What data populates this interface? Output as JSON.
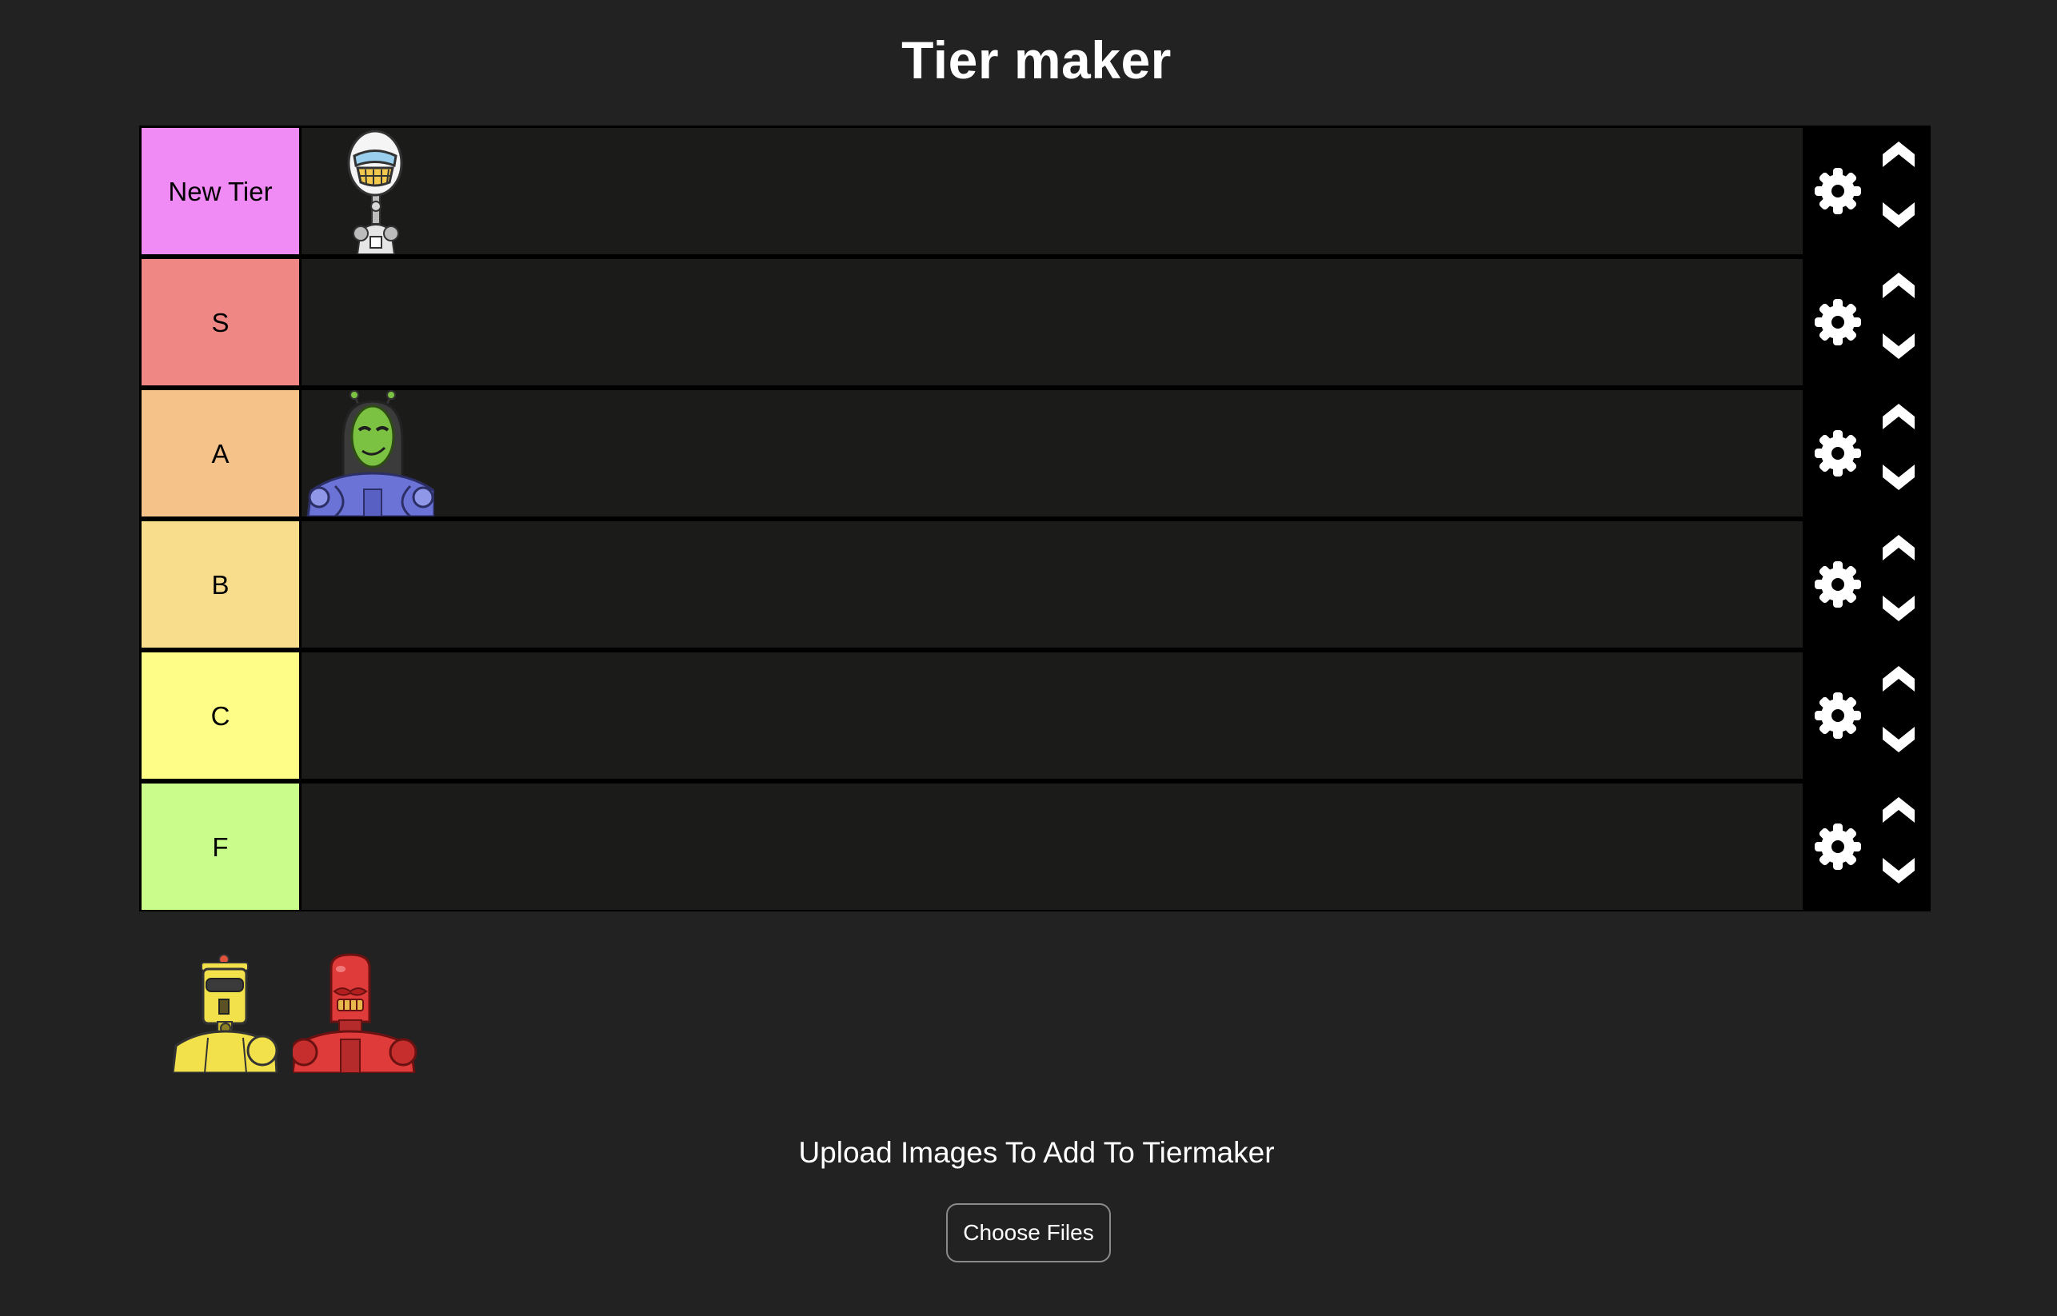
{
  "page": {
    "title": "Tier maker"
  },
  "tiers": [
    {
      "label": "New Tier",
      "color": "#f08bf5",
      "gear_icon": "gear-icon",
      "up_icon": "chevron-up-icon",
      "down_icon": "chevron-down-icon"
    },
    {
      "label": "S",
      "color": "#ef8885",
      "gear_icon": "gear-icon",
      "up_icon": "chevron-up-icon",
      "down_icon": "chevron-down-icon"
    },
    {
      "label": "A",
      "color": "#f5c38a",
      "gear_icon": "gear-icon",
      "up_icon": "chevron-up-icon",
      "down_icon": "chevron-down-icon"
    },
    {
      "label": "B",
      "color": "#f8dd8d",
      "gear_icon": "gear-icon",
      "up_icon": "chevron-up-icon",
      "down_icon": "chevron-down-icon"
    },
    {
      "label": "C",
      "color": "#fdfd88",
      "gear_icon": "gear-icon",
      "up_icon": "chevron-up-icon",
      "down_icon": "chevron-down-icon"
    },
    {
      "label": "F",
      "color": "#c9fc8b",
      "gear_icon": "gear-icon",
      "up_icon": "chevron-up-icon",
      "down_icon": "chevron-down-icon"
    }
  ],
  "placed_images": [
    {
      "tier": "New Tier",
      "icon": "white-egg-robot-image"
    },
    {
      "tier": "A",
      "icon": "green-alien-robot-image"
    }
  ],
  "unranked_images": [
    {
      "icon": "yellow-robot-image"
    },
    {
      "icon": "red-robot-image"
    }
  ],
  "upload": {
    "label": "Upload Images To Add To Tiermaker",
    "button_label": "Choose Files"
  },
  "colors": {
    "background": "#232223",
    "tier_row_background": "#1b1c19",
    "board_background": "#000000"
  }
}
